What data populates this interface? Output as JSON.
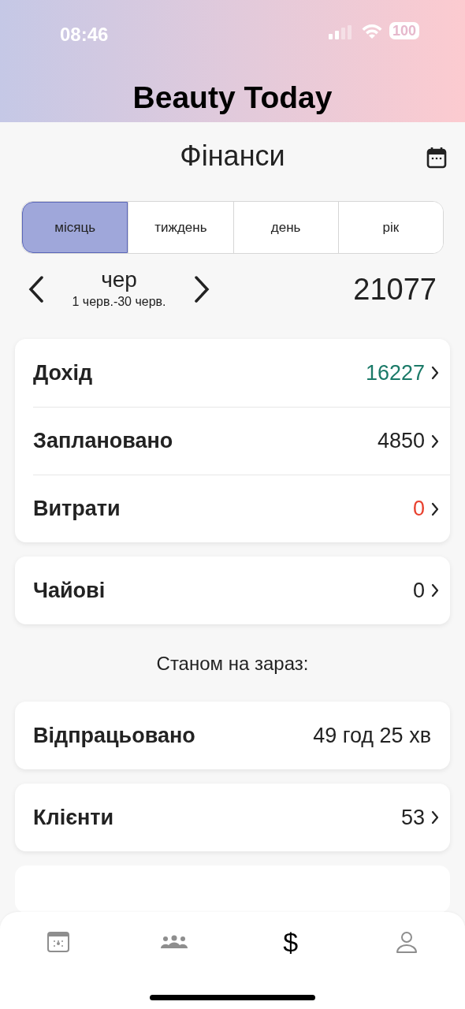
{
  "status_bar": {
    "time": "08:46",
    "battery": "100"
  },
  "app_title": "Beauty Today",
  "page_title": "Фінанси",
  "period_tabs": [
    {
      "label": "місяць",
      "selected": true
    },
    {
      "label": "тиждень",
      "selected": false
    },
    {
      "label": "день",
      "selected": false
    },
    {
      "label": "рік",
      "selected": false
    }
  ],
  "period": {
    "month": "чер",
    "range": "1 черв.-30 черв.",
    "total": "21077"
  },
  "groups": [
    {
      "rows": [
        {
          "label": "Дохід",
          "value": "16227",
          "color": "#1b7a68",
          "chevron": true
        },
        {
          "label": "Заплановано",
          "value": "4850",
          "color": "#222222",
          "chevron": true
        },
        {
          "label": "Витрати",
          "value": "0",
          "color": "#e8402e",
          "chevron": true
        }
      ]
    },
    {
      "rows": [
        {
          "label": "Чайові",
          "value": "0",
          "color": "#222222",
          "chevron": true
        }
      ]
    }
  ],
  "section_heading": "Станом на зараз:",
  "groups_now": [
    {
      "rows": [
        {
          "label": "Відпрацьовано",
          "value": "49 год 25 хв",
          "color": "#222222",
          "chevron": false
        }
      ]
    },
    {
      "rows": [
        {
          "label": "Клієнти",
          "value": "53",
          "color": "#222222",
          "chevron": true
        }
      ]
    }
  ],
  "tab_bar": [
    {
      "kind": "calendar",
      "selected": false
    },
    {
      "kind": "people",
      "selected": false
    },
    {
      "kind": "dollar",
      "label": "$",
      "selected": true
    },
    {
      "kind": "person",
      "selected": false
    }
  ]
}
